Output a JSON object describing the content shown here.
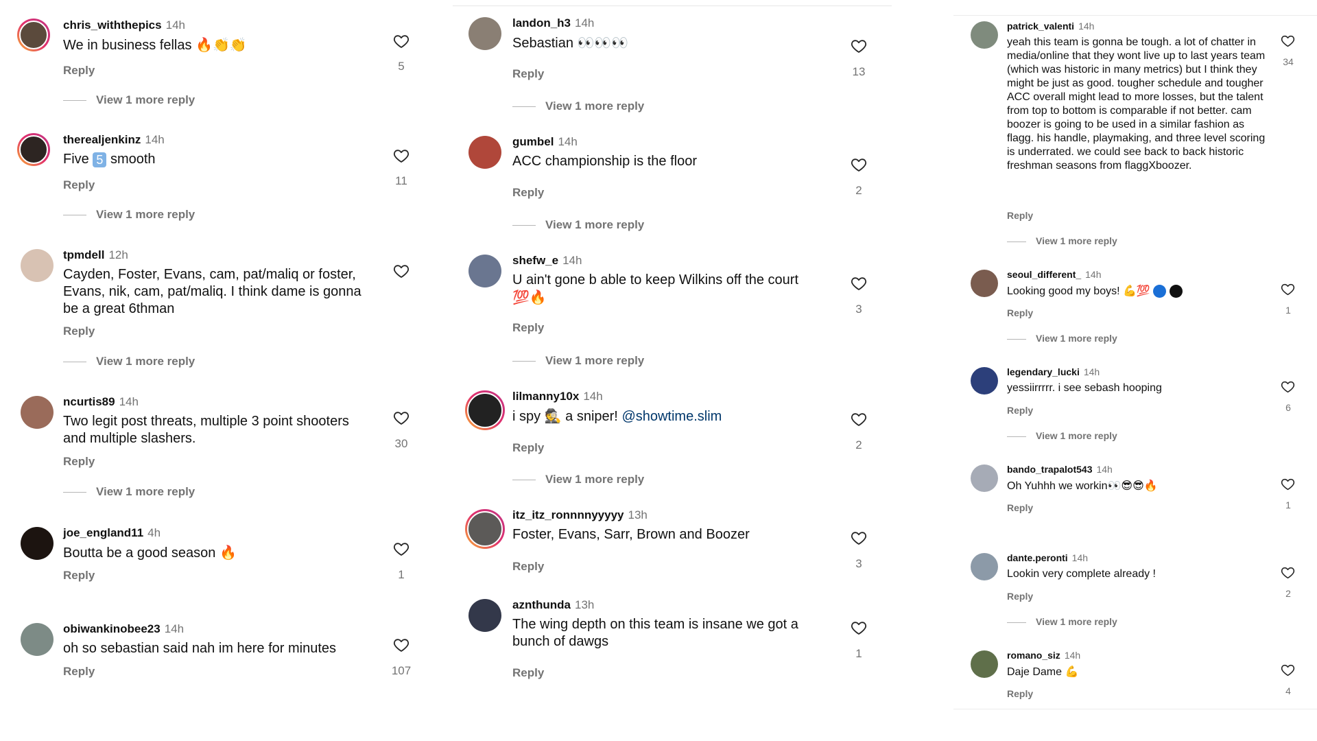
{
  "columns": [
    {
      "comments": [
        {
          "user": "chris_withthepics",
          "time": "14h",
          "text": "We in business fellas",
          "emoji": "🔥👏👏",
          "reply": "Reply",
          "likes": "5",
          "more": "View 1 more reply"
        },
        {
          "user": "therealjenkinz",
          "time": "14h",
          "text_a": "Five",
          "badge": "5",
          "text_b": "smooth",
          "reply": "Reply",
          "likes": "11",
          "more": "View 1 more reply"
        },
        {
          "user": "tpmdell",
          "time": "12h",
          "text": "Cayden, Foster, Evans, cam, pat/maliq or foster, Evans, nik, cam, pat/maliq. I think dame is gonna be a great  6thman",
          "reply": "Reply",
          "likes": "",
          "more": "View 1 more reply"
        },
        {
          "user": "ncurtis89",
          "time": "14h",
          "text": "Two legit post threats, multiple 3 point shooters and multiple slashers.",
          "reply": "Reply",
          "likes": "30",
          "more": "View 1 more reply"
        },
        {
          "user": "joe_england11",
          "time": "4h",
          "text": "Boutta be a good season",
          "emoji": "🔥",
          "reply": "Reply",
          "likes": "1"
        },
        {
          "user": "obiwankinobee23",
          "time": "14h",
          "text": "oh so sebastian said nah im here for minutes",
          "reply": "Reply",
          "likes": "107"
        }
      ]
    },
    {
      "comments": [
        {
          "user": "landon_h3",
          "time": "14h",
          "text": "Sebastian",
          "emoji": "👀👀👀",
          "reply": "Reply",
          "likes": "13",
          "more": "View 1 more reply"
        },
        {
          "user": "gumbel",
          "time": "14h",
          "text": "ACC championship is the floor",
          "reply": "Reply",
          "likes": "2",
          "more": "View 1 more reply"
        },
        {
          "user": "shefw_e",
          "time": "14h",
          "text": "U ain't gone b able to keep Wilkins off the court",
          "emoji": "💯🔥",
          "reply": "Reply",
          "likes": "3",
          "more": "View 1 more reply"
        },
        {
          "user": "lilmanny10x",
          "time": "14h",
          "text_a": "i spy",
          "emoji": "🕵",
          "text_b": "a sniper!",
          "mention": "@showtime.slim",
          "reply": "Reply",
          "likes": "2",
          "more": "View 1 more reply"
        },
        {
          "user": "itz_itz_ronnnnyyyyy",
          "time": "13h",
          "text": "Foster, Evans, Sarr, Brown and Boozer",
          "reply": "Reply",
          "likes": "3"
        },
        {
          "user": "aznthunda",
          "time": "13h",
          "text": "The wing depth on this team is insane we got a bunch of dawgs",
          "reply": "Reply",
          "likes": "1"
        }
      ]
    },
    {
      "comments": [
        {
          "user": "patrick_valenti",
          "time": "14h",
          "text": "yeah this team is gonna be tough. a lot of chatter in media/online that they wont live up to last years team (which was historic in many metrics) but I think they might be just as good. tougher schedule and tougher ACC overall might lead to more losses, but the talent from top to bottom is comparable if not better. cam boozer is going to be used in a similar fashion as flagg. his handle, playmaking, and three level scoring is underrated. we could see back to back historic freshman seasons from flaggXboozer.",
          "reply": "Reply",
          "likes": "34",
          "more": "View 1 more reply"
        },
        {
          "user": "seoul_different_",
          "time": "14h",
          "text": "Looking good my boys!",
          "emoji": "💪💯",
          "reply": "Reply",
          "likes": "1",
          "more": "View 1 more reply"
        },
        {
          "user": "legendary_lucki",
          "time": "14h",
          "text": "yessiirrrrr. i see sebash hooping",
          "reply": "Reply",
          "likes": "6",
          "more": "View 1 more reply"
        },
        {
          "user": "bando_trapalot543",
          "time": "14h",
          "text": "Oh Yuhhh we workin",
          "emoji": "👀😎😎🔥",
          "reply": "Reply",
          "likes": "1"
        },
        {
          "user": "dante.peronti",
          "time": "14h",
          "text": "Lookin very complete already !",
          "reply": "Reply",
          "likes": "2",
          "more": "View 1 more reply"
        },
        {
          "user": "romano_siz",
          "time": "14h",
          "text": "Daje Dame",
          "emoji": "💪",
          "reply": "Reply",
          "likes": "4"
        }
      ]
    }
  ],
  "colors": {
    "dot_blue": "#1a6fd6",
    "dot_black": "#111111",
    "badge": "#7fb2e5",
    "mention": "#00376b"
  }
}
